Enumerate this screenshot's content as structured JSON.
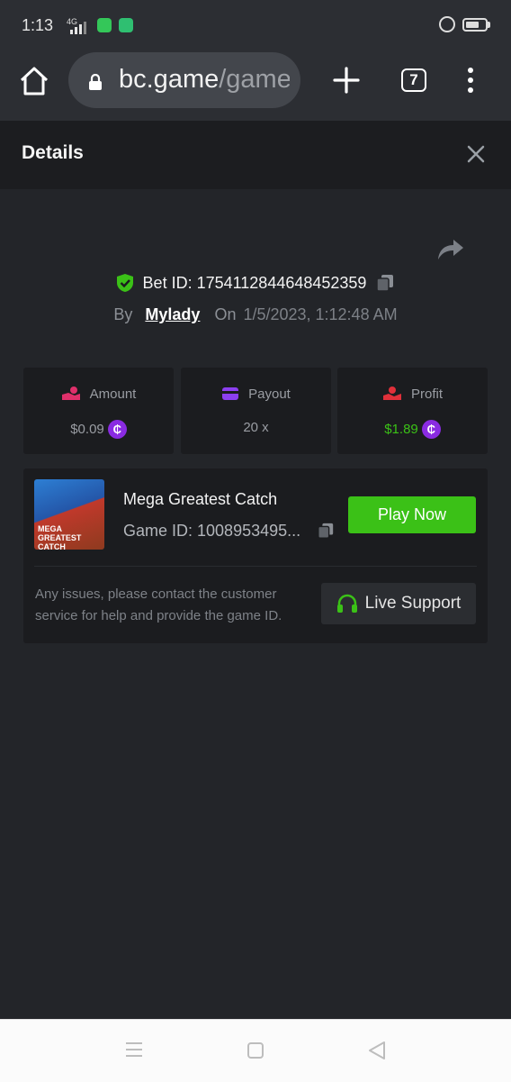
{
  "status_bar": {
    "time": "1:13",
    "network": "4G"
  },
  "browser": {
    "url_host": "bc.game",
    "url_path": "/game",
    "tab_count": "7"
  },
  "details": {
    "title": "Details",
    "bet_id_label": "Bet ID: 1754112844648452359",
    "by_label": "By",
    "user": "Mylady",
    "on_label": "On",
    "datetime": "1/5/2023, 1:12:48 AM"
  },
  "stats": [
    {
      "label": "Amount",
      "value": "$0.09",
      "icon": "hand-coin-icon",
      "value_color": "#9a9da3"
    },
    {
      "label": "Payout",
      "value": "20 x",
      "icon": "wallet-icon",
      "value_color": "#9a9da3"
    },
    {
      "label": "Profit",
      "value": "$1.89",
      "icon": "profit-hand-icon",
      "value_color": "#3bc117"
    }
  ],
  "game": {
    "name": "Mega Greatest Catch",
    "id_label": "Game ID: 1008953495...",
    "thumb_text": "MEGA GREATEST CATCH",
    "play_label": "Play Now",
    "issue_text": "Any issues, please contact the customer service for help and provide the game ID.",
    "support_label": "Live Support"
  },
  "colors": {
    "accent_green": "#3bc117",
    "coin_purple": "#8a2be2",
    "panel": "#1b1c1f",
    "background": "#232529"
  }
}
